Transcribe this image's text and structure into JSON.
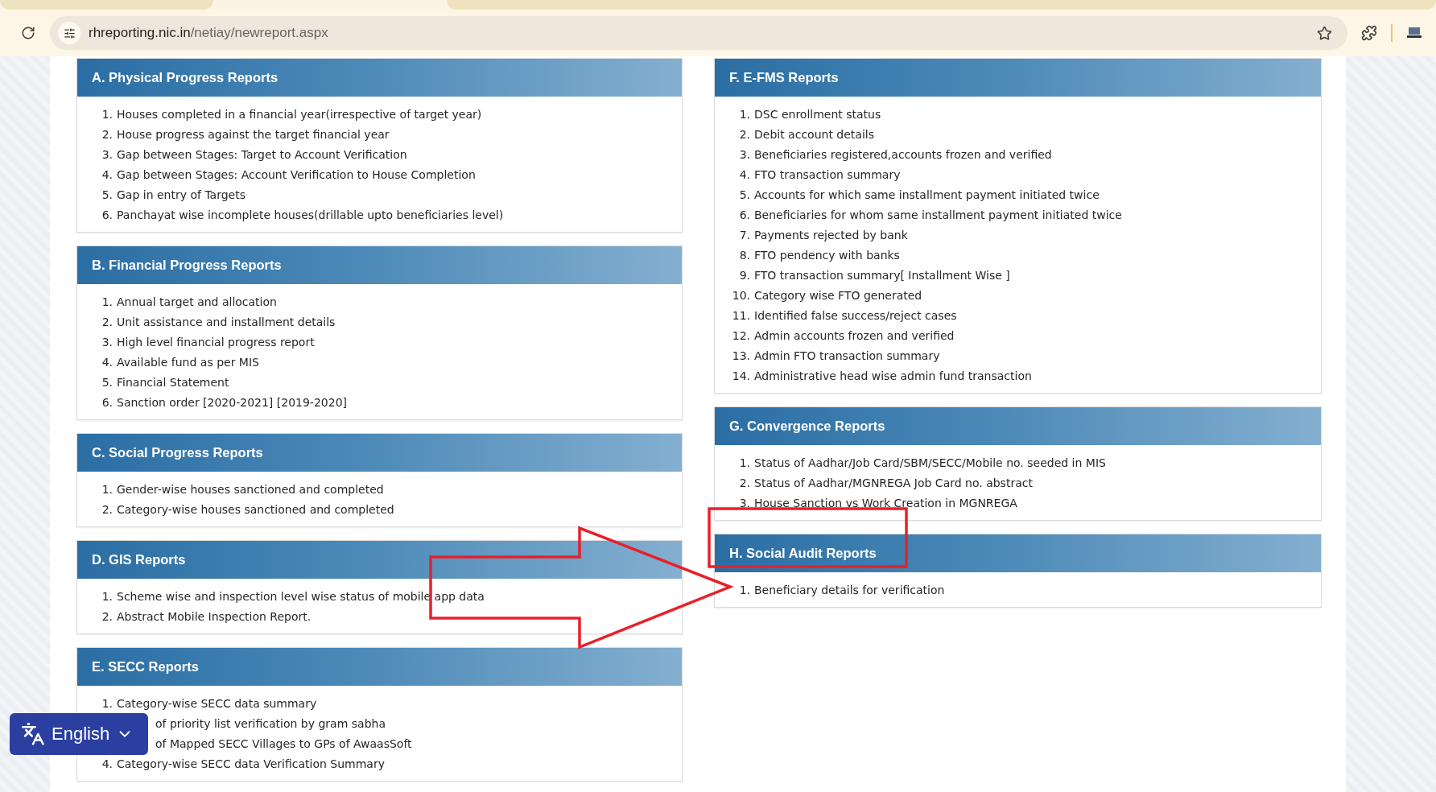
{
  "browser": {
    "url_host": "rhreporting.nic.in",
    "url_path": "/netiay/newreport.aspx"
  },
  "columns": [
    [
      {
        "title": "A. Physical Progress Reports",
        "items": [
          {
            "number": "1.",
            "text": "Houses completed in a financial year(irrespective of target year)"
          },
          {
            "number": "2.",
            "text": "House progress against the target financial year"
          },
          {
            "number": "3.",
            "text": "Gap between Stages: Target to Account Verification"
          },
          {
            "number": "4.",
            "text": "Gap between Stages: Account Verification to House Completion"
          },
          {
            "number": "5.",
            "text": "Gap in entry of Targets"
          },
          {
            "number": "6.",
            "text": "Panchayat wise incomplete houses(drillable upto beneficiaries level)"
          }
        ]
      },
      {
        "title": "B. Financial Progress Reports",
        "items": [
          {
            "number": "1.",
            "text": "Annual target and allocation"
          },
          {
            "number": "2.",
            "text": "Unit assistance and installment details"
          },
          {
            "number": "3.",
            "text": "High level financial progress report"
          },
          {
            "number": "4.",
            "text": "Available fund as per MIS"
          },
          {
            "number": "5.",
            "text": "Financial Statement"
          },
          {
            "number": "6.",
            "text": "Sanction order [2020-2021] [2019-2020]"
          }
        ]
      },
      {
        "title": "C. Social Progress Reports",
        "items": [
          {
            "number": "1.",
            "text": "Gender-wise houses sanctioned and completed"
          },
          {
            "number": "2.",
            "text": "Category-wise houses sanctioned and completed"
          }
        ]
      },
      {
        "title": "D. GIS Reports",
        "items": [
          {
            "number": "1.",
            "text": "Scheme wise and inspection level wise status of mobile app data"
          },
          {
            "number": "2.",
            "text": "Abstract Mobile Inspection Report."
          }
        ]
      },
      {
        "title": "E. SECC Reports",
        "items": [
          {
            "number": "1.",
            "text": "Category-wise SECC data summary"
          },
          {
            "text": "of priority list verification by gram sabha"
          },
          {
            "text": "of Mapped SECC Villages to GPs of AwaasSoft"
          },
          {
            "number": "4.",
            "text": "Category-wise SECC data Verification Summary"
          }
        ]
      }
    ],
    [
      {
        "title": "F. E-FMS Reports",
        "items": [
          {
            "number": "1.",
            "text": "DSC enrollment status"
          },
          {
            "number": "2.",
            "text": "Debit account details"
          },
          {
            "number": "3.",
            "text": "Beneficiaries registered,accounts frozen and verified"
          },
          {
            "number": "4.",
            "text": "FTO transaction summary"
          },
          {
            "number": "5.",
            "text": "Accounts for which same installment payment initiated twice"
          },
          {
            "number": "6.",
            "text": "Beneficiaries for whom same installment payment initiated twice"
          },
          {
            "number": "7.",
            "text": "Payments rejected by bank"
          },
          {
            "number": "8.",
            "text": "FTO pendency with banks"
          },
          {
            "number": "9.",
            "text": "FTO transaction summary[ Installment Wise ]"
          },
          {
            "number": "10.",
            "text": "Category wise FTO generated"
          },
          {
            "number": "11.",
            "text": "Identified false success/reject cases"
          },
          {
            "number": "12.",
            "text": "Admin accounts frozen and verified"
          },
          {
            "number": "13.",
            "text": "Admin FTO transaction summary"
          },
          {
            "number": "14.",
            "text": "Administrative head wise admin fund transaction"
          }
        ]
      },
      {
        "title": "G. Convergence Reports",
        "items": [
          {
            "number": "1.",
            "text": "Status of Aadhar/Job Card/SBM/SECC/Mobile no. seeded in MIS"
          },
          {
            "number": "2.",
            "text": "Status of Aadhar/MGNREGA Job Card no. abstract"
          },
          {
            "number": "3.",
            "text": "House Sanction vs Work Creation in MGNREGA"
          }
        ]
      },
      {
        "title": "H. Social Audit Reports",
        "items": [
          {
            "number": "1.",
            "text": "Beneficiary details for verification"
          }
        ]
      }
    ]
  ],
  "language_button": {
    "label": "English"
  },
  "annotations": {
    "arrow": true,
    "highlight_rectangle": true
  }
}
